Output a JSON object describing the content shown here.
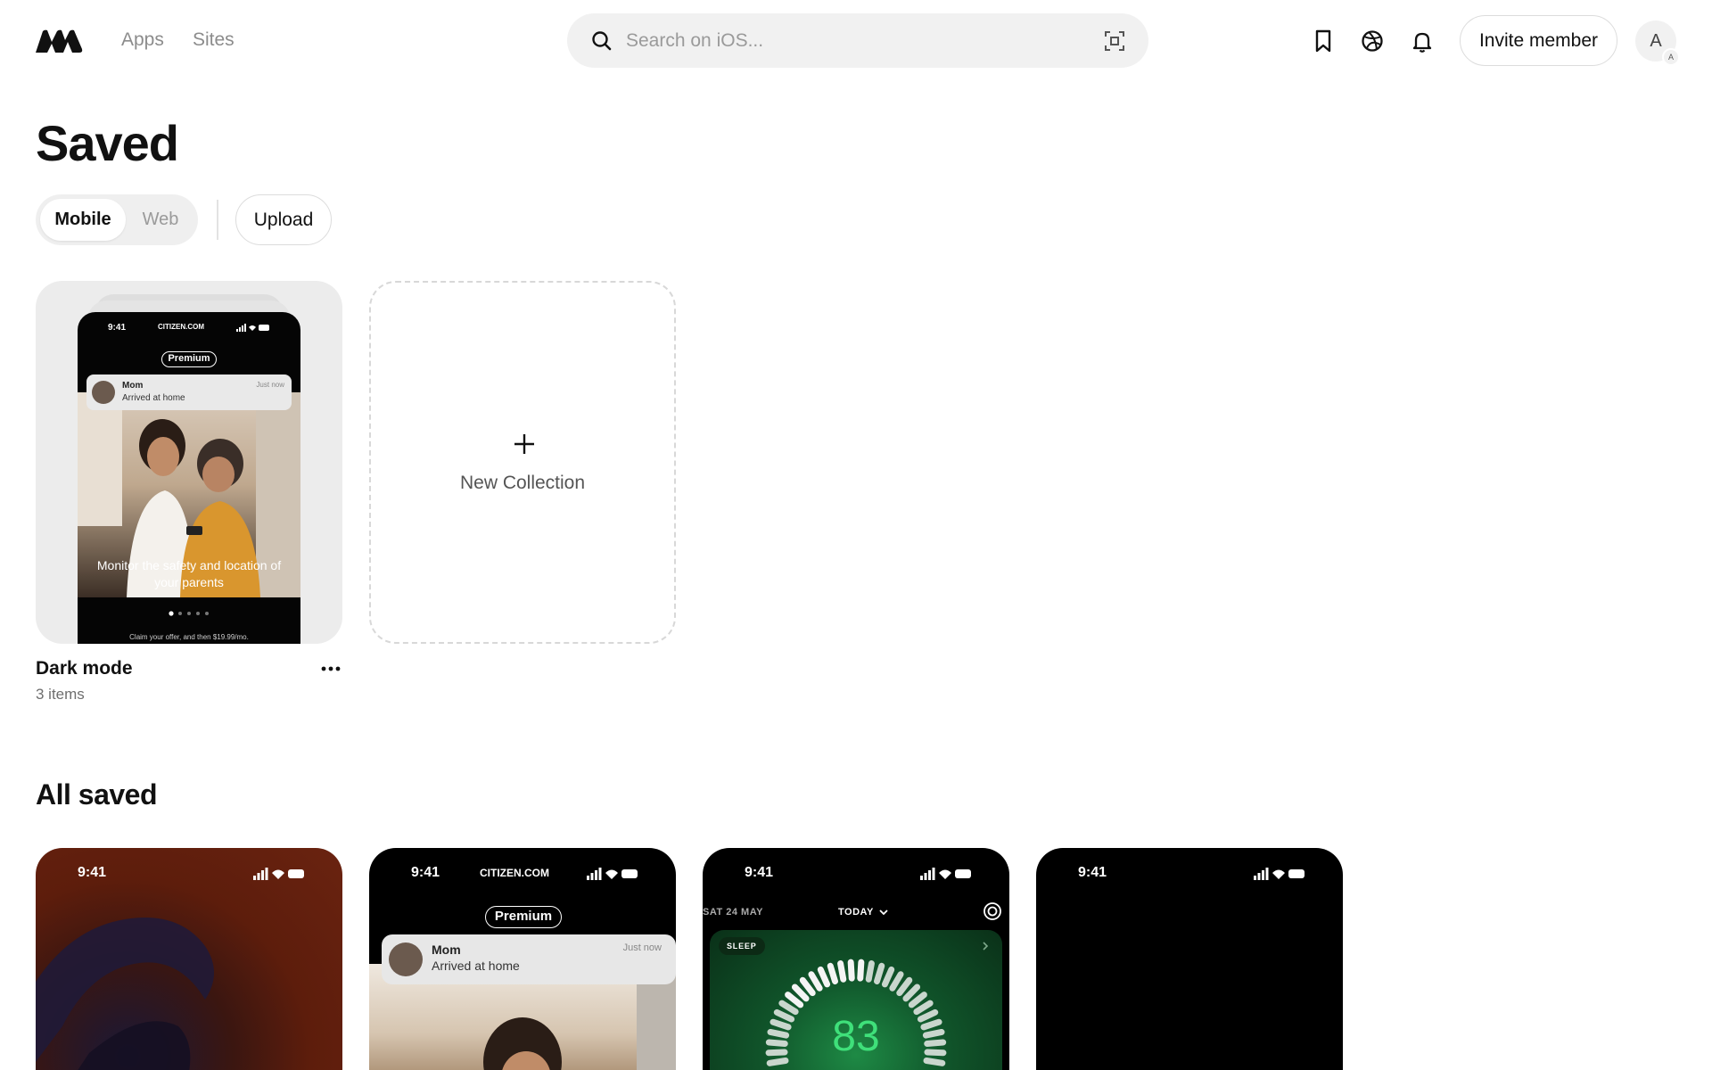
{
  "header": {
    "nav": [
      "Apps",
      "Sites"
    ],
    "search_placeholder": "Search on iOS...",
    "invite_label": "Invite member",
    "avatar_initial": "A",
    "avatar_badge": "A"
  },
  "saved": {
    "title": "Saved",
    "platform_tabs": [
      "Mobile",
      "Web"
    ],
    "active_tab": "Mobile",
    "upload_label": "Upload",
    "collections": [
      {
        "name": "Dark mode",
        "count": "3 items",
        "preview": {
          "time": "9:41",
          "url": "CITIZEN.COM",
          "badge": "Premium",
          "notif_sender": "Mom",
          "notif_message": "Arrived at home",
          "notif_time": "Just now",
          "caption": "Monitor the safety and location of your parents",
          "footer": "Claim your offer, and then $19.99/mo."
        }
      }
    ],
    "new_collection_label": "New Collection"
  },
  "all_saved": {
    "title": "All saved",
    "cards": [
      {
        "time": "9:41"
      },
      {
        "time": "9:41",
        "url": "CITIZEN.COM",
        "badge": "Premium",
        "notif_sender": "Mom",
        "notif_message": "Arrived at home",
        "notif_time": "Just now"
      },
      {
        "time": "9:41",
        "date": "SAT 24 MAY",
        "range": "TODAY",
        "tag": "SLEEP",
        "score": "83"
      },
      {
        "time": "9:41"
      }
    ]
  },
  "colors": {
    "accent_text": "#111111",
    "muted_text": "#8c8c8c",
    "sleep_score": "#3fe07a"
  }
}
